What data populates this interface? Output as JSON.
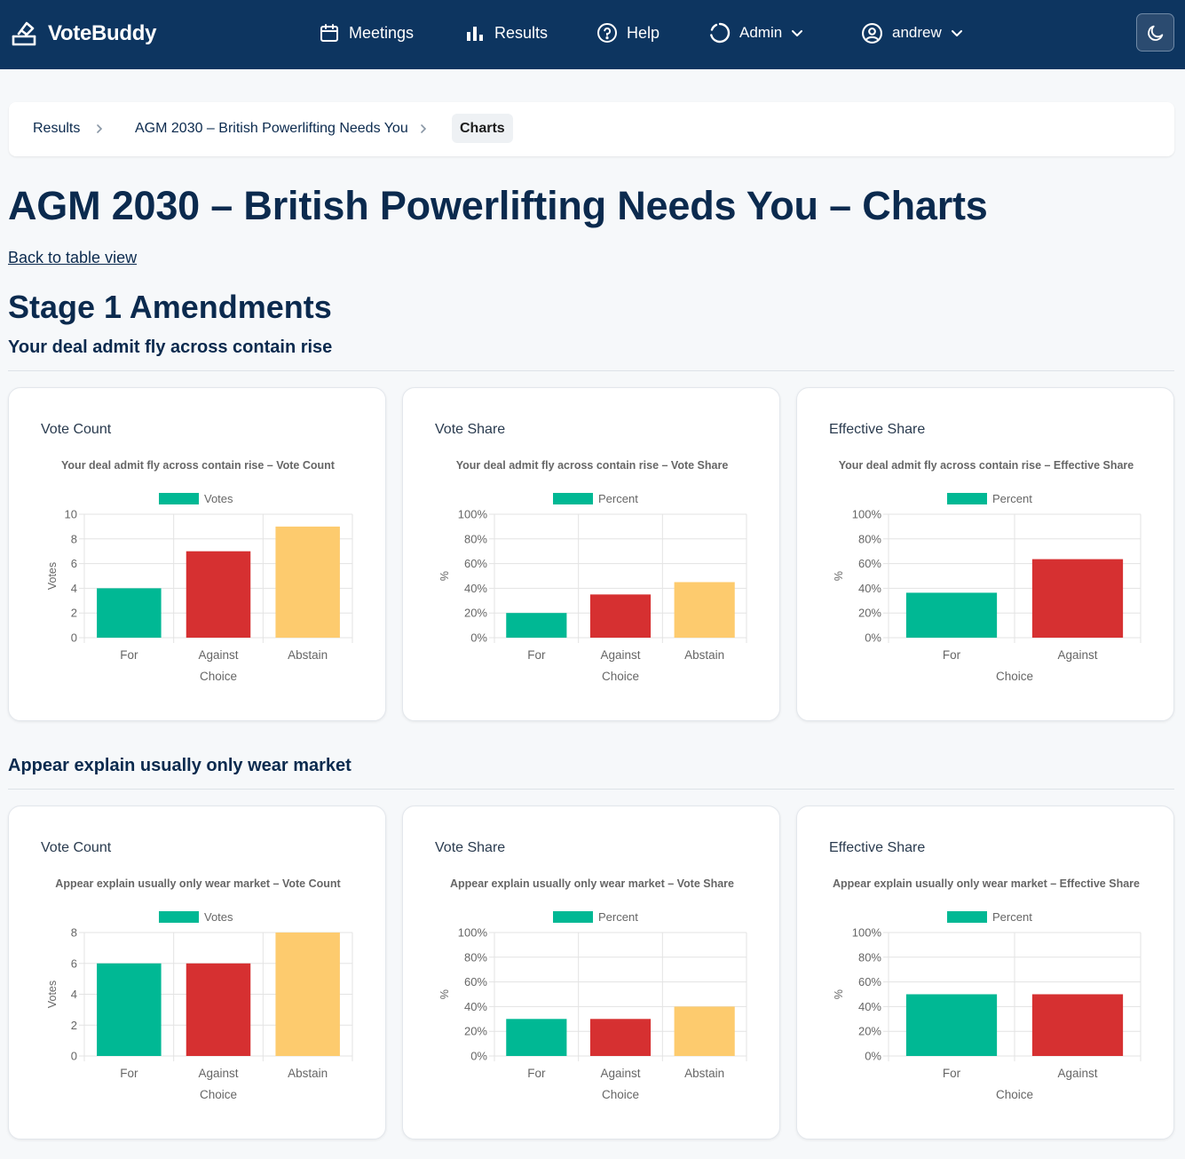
{
  "app": {
    "brand": "VoteBuddy",
    "nav": {
      "meetings": "Meetings",
      "results": "Results",
      "help": "Help",
      "admin": "Admin",
      "user": "andrew"
    }
  },
  "breadcrumb": {
    "items": [
      "Results",
      "AGM 2030 – British Powerlifting Needs You"
    ],
    "active": "Charts"
  },
  "page": {
    "title": "AGM 2030 – British Powerlifting Needs You – Charts",
    "back_link": "Back to table view",
    "stage_title": "Stage 1 Amendments"
  },
  "colors": {
    "for": "#00b894",
    "against": "#d63031",
    "abstain": "#fdcb6e",
    "navbar": "#0d3560"
  },
  "motions": [
    {
      "title": "Your deal admit fly across contain rise",
      "cards": [
        {
          "label": "Vote Count",
          "chart_data": {
            "type": "bar",
            "title": "Your deal admit fly across contain rise  – Vote Count",
            "legend": "Votes",
            "legend_position": "top",
            "categories": [
              "For",
              "Against",
              "Abstain"
            ],
            "values": [
              4,
              7,
              9
            ],
            "xlabel": "Choice",
            "ylabel": "Votes",
            "ylim": [
              0,
              10
            ],
            "yticks": [
              "0",
              "2",
              "4",
              "6",
              "8",
              "10"
            ],
            "grid": true
          }
        },
        {
          "label": "Vote Share",
          "chart_data": {
            "type": "bar",
            "title": "Your deal admit fly across contain rise  – Vote Share",
            "legend": "Percent",
            "legend_position": "top",
            "categories": [
              "For",
              "Against",
              "Abstain"
            ],
            "values": [
              20,
              35,
              45
            ],
            "xlabel": "Choice",
            "ylabel": "%",
            "ylim": [
              0,
              100
            ],
            "yticks": [
              "0%",
              "20%",
              "40%",
              "60%",
              "80%",
              "100%"
            ],
            "grid": true
          }
        },
        {
          "label": "Effective Share",
          "chart_data": {
            "type": "bar",
            "title": "Your deal admit fly across contain rise  – Effective Share",
            "legend": "Percent",
            "legend_position": "top",
            "categories": [
              "For",
              "Against"
            ],
            "values": [
              36.4,
              63.6
            ],
            "xlabel": "Choice",
            "ylabel": "%",
            "ylim": [
              0,
              100
            ],
            "yticks": [
              "0%",
              "20%",
              "40%",
              "60%",
              "80%",
              "100%"
            ],
            "grid": true
          }
        }
      ]
    },
    {
      "title": "Appear explain usually only wear market",
      "cards": [
        {
          "label": "Vote Count",
          "chart_data": {
            "type": "bar",
            "title": "Appear explain usually only wear market  – Vote Count",
            "legend": "Votes",
            "legend_position": "top",
            "categories": [
              "For",
              "Against",
              "Abstain"
            ],
            "values": [
              6,
              6,
              8
            ],
            "xlabel": "Choice",
            "ylabel": "Votes",
            "ylim": [
              0,
              8
            ],
            "yticks": [
              "0",
              "2",
              "4",
              "6",
              "8"
            ],
            "grid": true
          }
        },
        {
          "label": "Vote Share",
          "chart_data": {
            "type": "bar",
            "title": "Appear explain usually only wear market  – Vote Share",
            "legend": "Percent",
            "legend_position": "top",
            "categories": [
              "For",
              "Against",
              "Abstain"
            ],
            "values": [
              30,
              30,
              40
            ],
            "xlabel": "Choice",
            "ylabel": "%",
            "ylim": [
              0,
              100
            ],
            "yticks": [
              "0%",
              "20%",
              "40%",
              "60%",
              "80%",
              "100%"
            ],
            "grid": true
          }
        },
        {
          "label": "Effective Share",
          "chart_data": {
            "type": "bar",
            "title": "Appear explain usually only wear market  – Effective Share",
            "legend": "Percent",
            "legend_position": "top",
            "categories": [
              "For",
              "Against"
            ],
            "values": [
              50,
              50
            ],
            "xlabel": "Choice",
            "ylabel": "%",
            "ylim": [
              0,
              100
            ],
            "yticks": [
              "0%",
              "20%",
              "40%",
              "60%",
              "80%",
              "100%"
            ],
            "grid": true
          }
        }
      ]
    }
  ]
}
